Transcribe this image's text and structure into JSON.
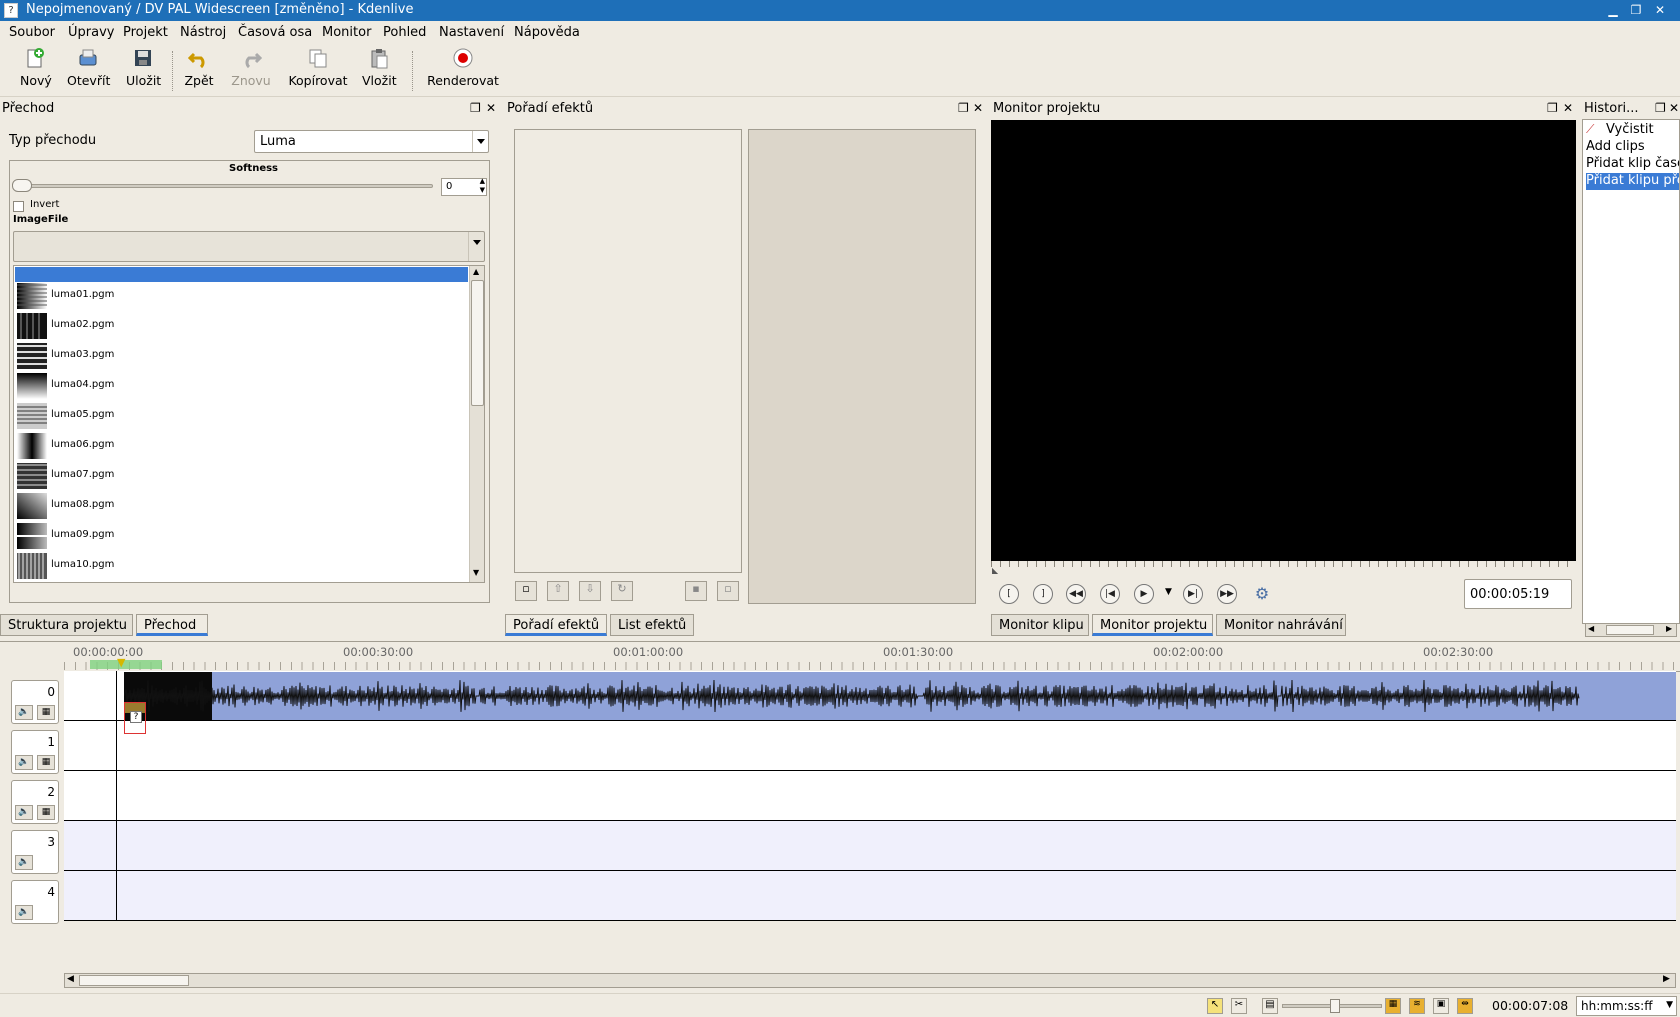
{
  "window": {
    "title": "Nepojmenovaný / DV PAL Widescreen [změněno] - Kdenlive"
  },
  "menubar": [
    "Soubor",
    "Úpravy",
    "Projekt",
    "Nástroj",
    "Časová osa",
    "Monitor",
    "Pohled",
    "Nastavení",
    "Nápověda"
  ],
  "toolbar": {
    "new": "Nový",
    "open": "Otevřít",
    "save": "Uložit",
    "undo": "Zpět",
    "redo": "Znovu",
    "copy": "Kopírovat",
    "paste": "Vložit",
    "render": "Renderovat"
  },
  "transition_panel": {
    "title": "Přechod",
    "type_label": "Typ přechodu",
    "type_value": "Luma",
    "softness_label": "Softness",
    "softness_value": "0",
    "invert_label": "Invert",
    "imagefile_label": "ImageFile",
    "files": [
      "luma01.pgm",
      "luma02.pgm",
      "luma03.pgm",
      "luma04.pgm",
      "luma05.pgm",
      "luma06.pgm",
      "luma07.pgm",
      "luma08.pgm",
      "luma09.pgm",
      "luma10.pgm"
    ]
  },
  "left_tabs": [
    "Struktura projektu",
    "Přechod"
  ],
  "effects_panel": {
    "title": "Pořadí efektů"
  },
  "middle_tabs": [
    "Pořadí efektů",
    "List efektů"
  ],
  "monitor_panel": {
    "title": "Monitor projektu",
    "timecode": "00:00:05:19"
  },
  "monitor_tabs": [
    "Monitor klipu",
    "Monitor projektu",
    "Monitor nahrávání"
  ],
  "history_panel": {
    "title": "Histori...",
    "items": [
      "Vyčistit",
      "Add clips",
      "Přidat klip časo",
      "Přidat klipu pře"
    ]
  },
  "timeline": {
    "ruler_labels": [
      "00:00:00:00",
      "00:00:30:00",
      "00:01:00:00",
      "00:01:30:00",
      "00:02:00:00",
      "00:02:30:00"
    ],
    "tracks": [
      "0",
      "1",
      "2",
      "3",
      "4"
    ]
  },
  "statusbar": {
    "timecode": "00:00:07:08",
    "format": "hh:mm:ss:ff"
  },
  "colors": {
    "titlebar": "#1e6fb8",
    "selection": "#3a7bd5",
    "clip": "#8fa2d8"
  }
}
